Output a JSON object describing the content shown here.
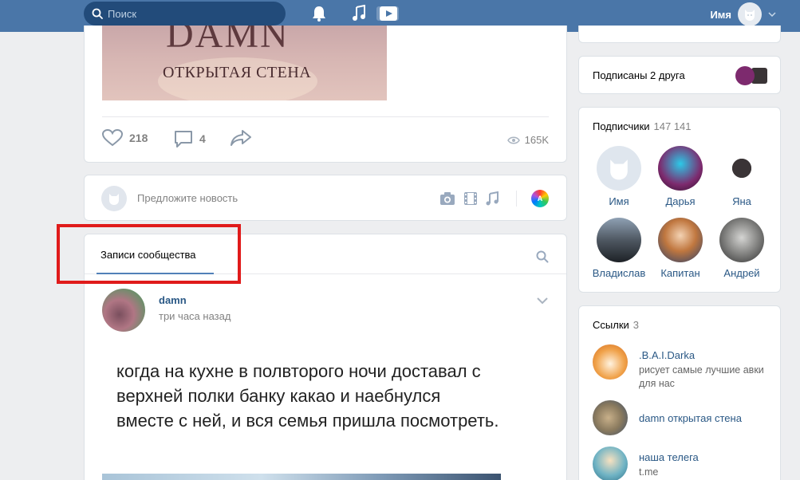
{
  "header": {
    "search_placeholder": "Поиск",
    "user_name": "Имя"
  },
  "post_top": {
    "image_title": "DAMN",
    "image_subtitle": "ОТКРЫТАЯ СТЕНА",
    "likes": "218",
    "comments": "4",
    "views": "165K"
  },
  "suggest": {
    "placeholder": "Предложите новость"
  },
  "feed": {
    "tab_label": "Записи сообщества",
    "author": "damn",
    "time": "три часа назад",
    "text": "когда на кухне в полвторого ночи доставал с верхней полки банку какао и наебнулся вместе с ней, и вся семья пришла посмотреть."
  },
  "right": {
    "friends_label": "Подписаны 2 друга",
    "subscribers_label": "Подписчики",
    "subscribers_count": "147 141",
    "subscribers": [
      {
        "name": "Имя",
        "color": "#dfe6ee"
      },
      {
        "name": "Дарья",
        "color": "#7d2a6e"
      },
      {
        "name": "Яна",
        "color": "#3a3436"
      },
      {
        "name": "Владислав",
        "color": "#4f5862"
      },
      {
        "name": "Капитан",
        "color": "#c0773f"
      },
      {
        "name": "Андрей",
        "color": "#8a8a88"
      }
    ],
    "links_label": "Ссылки",
    "links_count": "3",
    "links": [
      {
        "title": ".B.A.I.Darka",
        "desc": "рисует самые лучшие авки для нас",
        "color": "#f0a24a"
      },
      {
        "title": "damn открытая стена",
        "desc": "",
        "color": "#8a7a5e"
      },
      {
        "title": "наша телега",
        "desc": "t.me",
        "color": "#6fb3c4"
      }
    ]
  },
  "colors": {
    "header_bg": "#4a76a8",
    "link": "#2a5885",
    "highlight": "#e01b1b"
  }
}
